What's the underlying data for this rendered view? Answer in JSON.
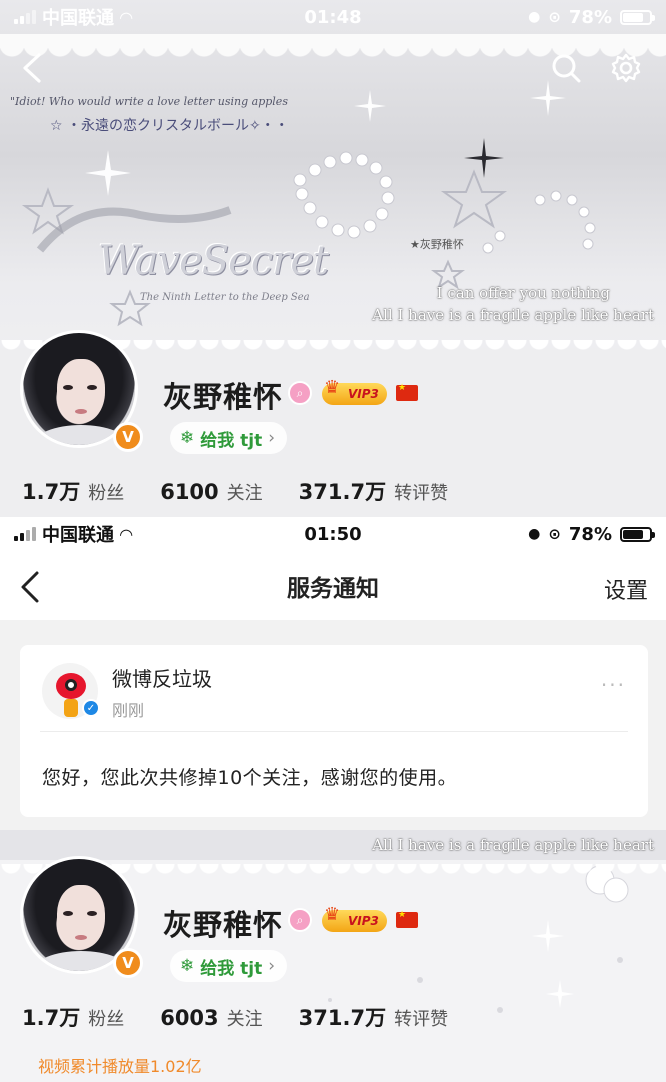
{
  "screen1": {
    "status_bar": {
      "carrier": "中国联通",
      "time": "01:48",
      "battery": "78%"
    },
    "header_buttons": {
      "back": "back",
      "search": "search",
      "settings": "settings"
    },
    "banner": {
      "line1": "\"Idiot! Who would write a love letter using apples",
      "line2": "☆ ・永遠の恋クリスタルボール✧・・",
      "brand": "WaveSecret",
      "brand_sub": "The Ninth Letter to the Deep Sea",
      "tag": "★灰野稚怀",
      "quote1": "I can offer you nothing",
      "quote2": "All I have is a fragile apple  like heart"
    },
    "profile": {
      "name": "灰野稚怀",
      "vip_label": "VIP3",
      "gift_label": "给我 tjt",
      "verified_label": "V"
    },
    "stats": [
      {
        "value": "1.7万",
        "label": "粉丝"
      },
      {
        "value": "6100",
        "label": "关注"
      },
      {
        "value": "371.7万",
        "label": "转评赞"
      }
    ]
  },
  "screen2": {
    "status_bar": {
      "carrier": "中国联通",
      "time": "01:50",
      "battery": "78%"
    },
    "nav": {
      "title": "服务通知",
      "settings": "设置"
    },
    "notification": {
      "sender": "微博反垃圾",
      "time": "刚刚",
      "more": "···",
      "message": "您好，您此次共修掉10个关注，感谢您的使用。"
    }
  },
  "screen3": {
    "banner": {
      "quote2": "All I have is a fragile apple  like heart"
    },
    "profile": {
      "name": "灰野稚怀",
      "vip_label": "VIP3",
      "gift_label": "给我 tjt",
      "verified_label": "V"
    },
    "stats": [
      {
        "value": "1.7万",
        "label": "粉丝"
      },
      {
        "value": "6003",
        "label": "关注"
      },
      {
        "value": "371.7万",
        "label": "转评赞"
      }
    ],
    "play_count": "视频累计播放量1.02亿"
  },
  "colors": {
    "accent_orange": "#f08a2b",
    "weibo_red": "#e6162d",
    "verified_blue": "#1e88e5",
    "gift_green": "#2f9a3a",
    "vip_gold": "#f3a515"
  }
}
